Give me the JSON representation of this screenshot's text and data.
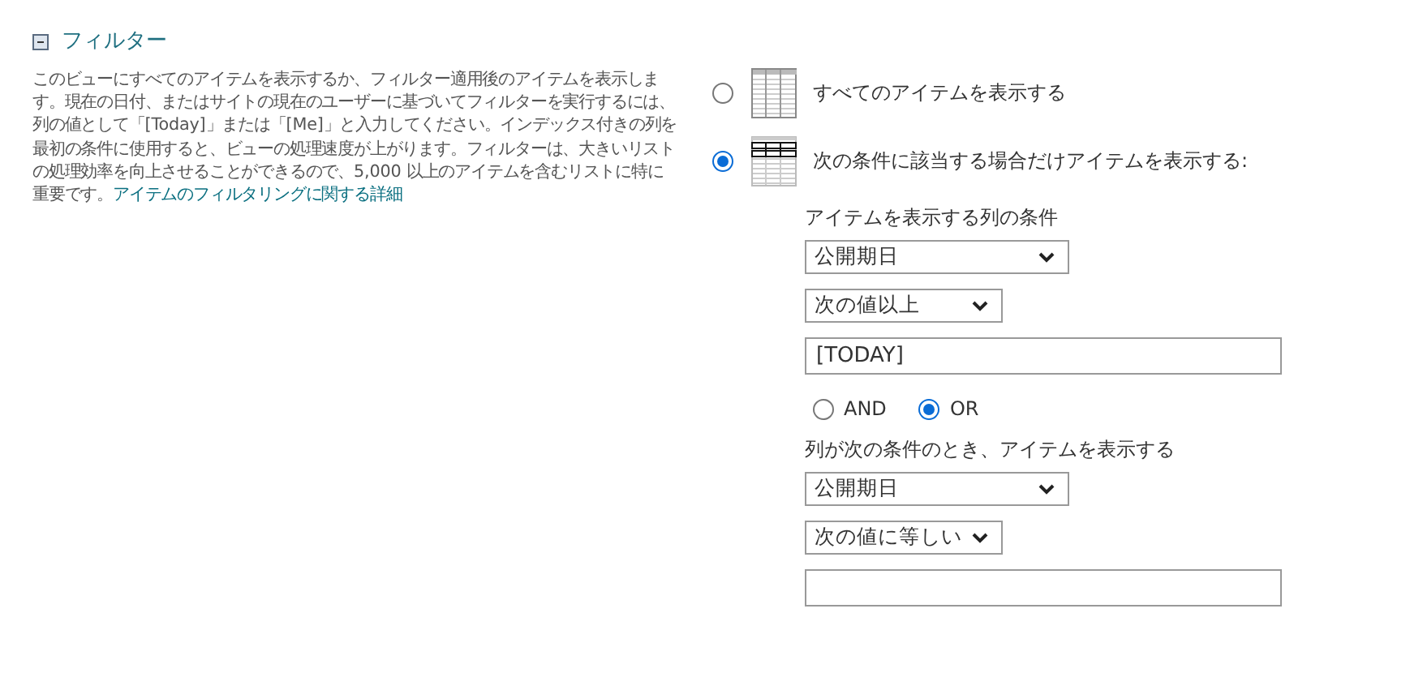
{
  "section": {
    "title": "フィルター",
    "expanded": true,
    "description": "このビューにすべてのアイテムを表示するか、フィルター適用後のアイテムを表示します。現在の日付、またはサイトの現在のユーザーに基づいてフィルターを実行するには、列の値として「[Today]」または「[Me]」と入力してください。インデックス付きの列を最初の条件に使用すると、ビューの処理速度が上がります。フィルターは、大きいリストの処理効率を向上させることができるので、5,000 以上のアイテムを含むリストに特に重要です。",
    "link": "アイテムのフィルタリングに関する詳細"
  },
  "options": [
    {
      "kind": "all",
      "label": "すべてのアイテムを表示する",
      "selected": false
    },
    {
      "kind": "filtered",
      "label": "次の条件に該当する場合だけアイテムを表示する:",
      "selected": true
    }
  ],
  "conditions": [
    {
      "label": "アイテムを表示する列の条件",
      "column": "公開期日",
      "operator": "次の値以上",
      "value": "[TODAY]"
    },
    {
      "label": "列が次の条件のとき、アイテムを表示する",
      "column": "公開期日",
      "operator": "次の値に等しい"
    }
  ],
  "join": [
    {
      "label": "AND",
      "selected": false
    },
    {
      "label": "OR",
      "selected": true
    }
  ]
}
